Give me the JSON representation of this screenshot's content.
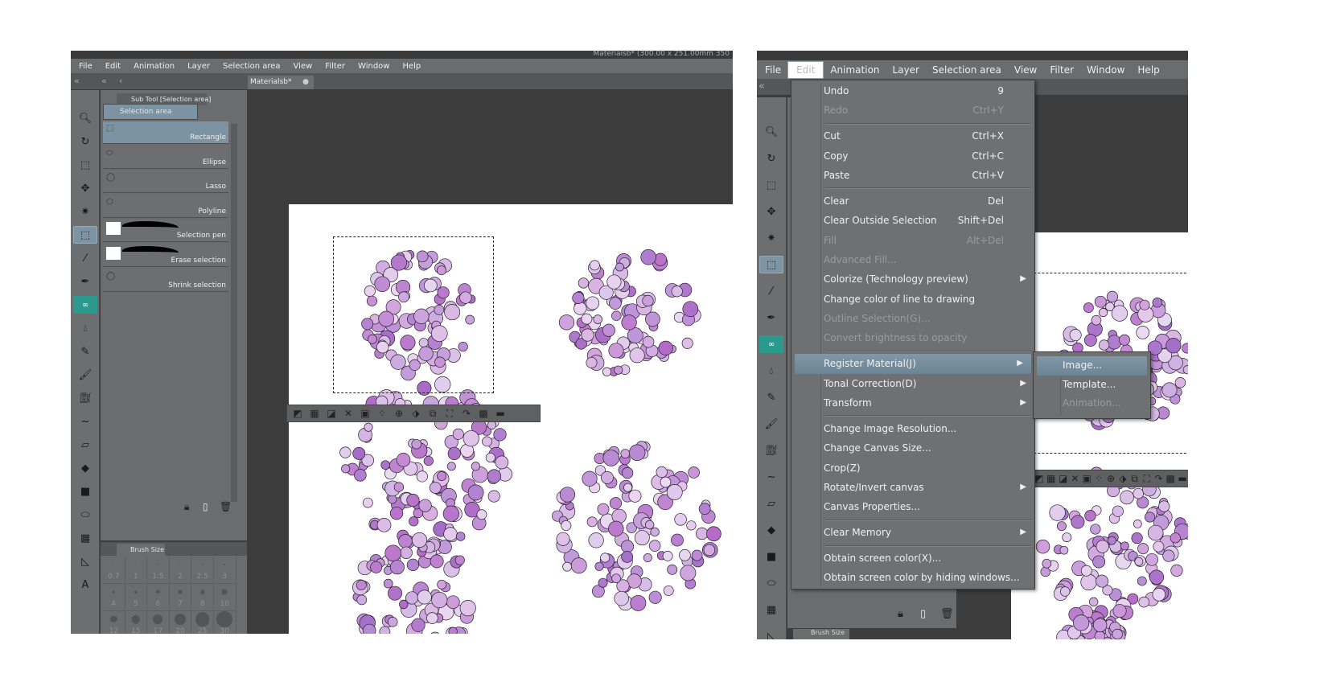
{
  "left_window": {
    "title": "Materialsb* (300.00 x 251.00mm 350",
    "menu": [
      "File",
      "Edit",
      "Animation",
      "Layer",
      "Selection area",
      "View",
      "Filter",
      "Window",
      "Help"
    ],
    "document_tab": "Materialsb*",
    "subtool_panel": {
      "tab_label": "Sub Tool [Selection area]",
      "group_label": "Selection area",
      "items": [
        "Rectangle",
        "Ellipse",
        "Lasso",
        "Polyline",
        "Selection pen",
        "Erase selection",
        "Shrink selection"
      ],
      "selected": "Rectangle"
    },
    "brush_size_panel": {
      "tab_label": "Brush Size",
      "sizes": [
        "0.7",
        "1",
        "1.5",
        "2",
        "2.5",
        "3",
        "4",
        "5",
        "6",
        "7",
        "8",
        "10",
        "12",
        "15",
        "17",
        "20",
        "25",
        "30"
      ]
    },
    "tools": [
      "zoom-icon",
      "rotate-icon",
      "object-icon",
      "move-layer-icon",
      "auto-select-icon",
      "selection-icon",
      "eyedropper-icon",
      "pen-icon",
      "decoration-icon",
      "blend-icon",
      "pencil-icon",
      "brush-icon",
      "airbrush-icon",
      "smudge-icon",
      "eraser-icon",
      "fill-icon",
      "gradient-icon",
      "figure-icon",
      "frame-icon",
      "ruler-icon",
      "text-icon"
    ]
  },
  "right_window": {
    "menu": [
      "File",
      "Edit",
      "Animation",
      "Layer",
      "Selection area",
      "View",
      "Filter",
      "Window",
      "Help"
    ],
    "open_menu": "Edit",
    "edit_menu": [
      {
        "label": "Undo",
        "shortcut": "9"
      },
      {
        "label": "Redo",
        "shortcut": "Ctrl+Y",
        "disabled": true
      },
      {
        "sep": true
      },
      {
        "label": "Cut",
        "shortcut": "Ctrl+X"
      },
      {
        "label": "Copy",
        "shortcut": "Ctrl+C"
      },
      {
        "label": "Paste",
        "shortcut": "Ctrl+V"
      },
      {
        "sep": true
      },
      {
        "label": "Clear",
        "shortcut": "Del"
      },
      {
        "label": "Clear Outside Selection",
        "shortcut": "Shift+Del"
      },
      {
        "label": "Fill",
        "shortcut": "Alt+Del",
        "disabled": true
      },
      {
        "label": "Advanced Fill...",
        "disabled": true
      },
      {
        "label": "Colorize (Technology preview)",
        "submenu": true
      },
      {
        "label": "Change color of line to drawing"
      },
      {
        "label": "Outline Selection(G)...",
        "disabled": true
      },
      {
        "label": "Convert brightness to opacity",
        "disabled": true
      },
      {
        "sep": true
      },
      {
        "label": "Register Material(J)",
        "submenu": true,
        "highlighted": true
      },
      {
        "label": "Tonal Correction(D)",
        "submenu": true
      },
      {
        "label": "Transform",
        "submenu": true
      },
      {
        "sep": true
      },
      {
        "label": "Change Image Resolution..."
      },
      {
        "label": "Change Canvas Size..."
      },
      {
        "label": "Crop(Z)"
      },
      {
        "label": "Rotate/Invert canvas",
        "submenu": true
      },
      {
        "label": "Canvas Properties..."
      },
      {
        "sep": true
      },
      {
        "label": "Clear Memory",
        "submenu": true
      },
      {
        "sep": true
      },
      {
        "label": "Obtain screen color(X)..."
      },
      {
        "label": "Obtain screen color by hiding windows..."
      }
    ],
    "register_submenu": [
      {
        "label": "Image...",
        "highlighted": true
      },
      {
        "label": "Template..."
      },
      {
        "label": "Animation...",
        "disabled": true
      }
    ],
    "brush_size_tab": "Brush Size",
    "arrow_glyph": "▶"
  },
  "colors": {
    "menu_bg": "#6f7072",
    "highlight": "#7b93a2",
    "canvas_bg": "#3c3c3c",
    "flower": "#b391cf"
  }
}
